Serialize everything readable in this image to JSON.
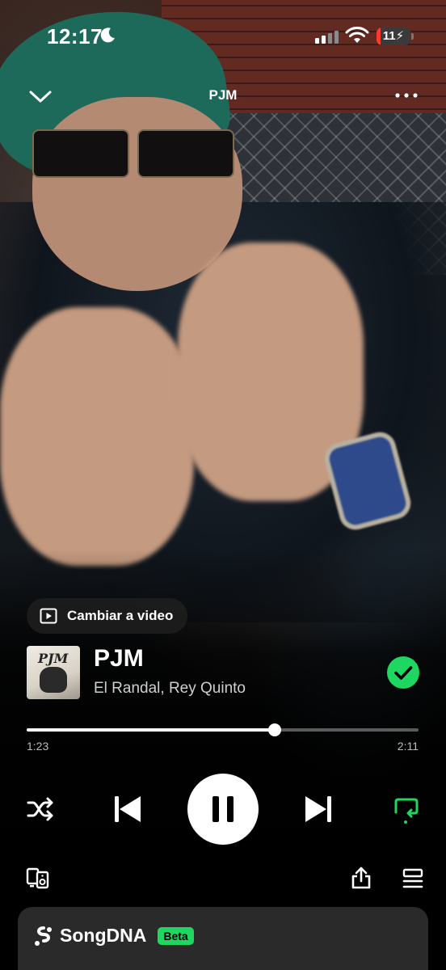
{
  "status_bar": {
    "time": "12:17",
    "battery": "11",
    "battery_level": 0.11,
    "icons": [
      "moon-icon",
      "cellular-signal-icon",
      "wifi-icon",
      "battery-charging-icon"
    ]
  },
  "header": {
    "title": "PJM",
    "left_icon": "chevron-down-icon",
    "right_icon": "more-options-icon"
  },
  "video_switch": {
    "label": "Cambiar a video",
    "icon": "play-video-icon"
  },
  "track": {
    "title": "PJM",
    "artist": "El Randal, Rey Quinto",
    "album_art_text": "PJM",
    "saved": true,
    "saved_icon": "check-circle-icon"
  },
  "progress": {
    "current": "1:23",
    "total": "2:11",
    "fraction": 0.6336
  },
  "controls": {
    "shuffle_icon": "shuffle-icon",
    "previous_icon": "skip-previous-icon",
    "play_pause_icon": "pause-icon",
    "next_icon": "skip-next-icon",
    "repeat_icon": "repeat-one-icon",
    "repeat_active": true
  },
  "bottom_bar": {
    "devices_icon": "connect-devices-icon",
    "share_icon": "share-icon",
    "queue_icon": "queue-icon"
  },
  "songdna": {
    "title": "SongDNA",
    "badge": "Beta",
    "icon": "songdna-icon"
  },
  "colors": {
    "accent": "#1ed760",
    "background": "#000000",
    "battery_low": "#ff3b30"
  }
}
